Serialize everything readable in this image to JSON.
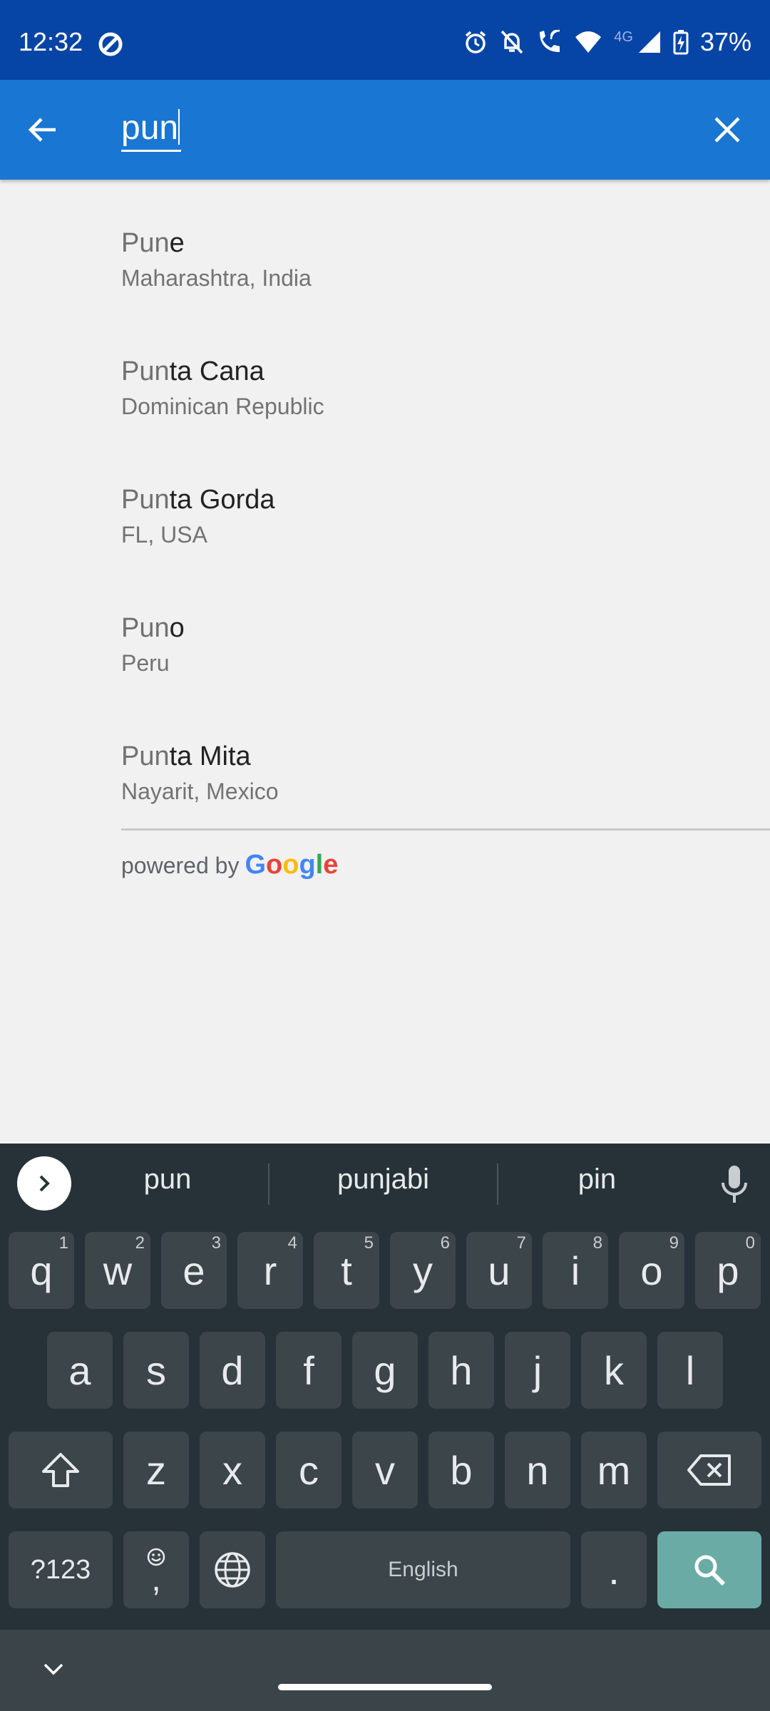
{
  "status": {
    "time": "12:32",
    "network": "4G",
    "battery": "37%"
  },
  "search": {
    "query": "pun"
  },
  "results": [
    {
      "match": "Pun",
      "rest": "e",
      "subtitle": "Maharashtra, India"
    },
    {
      "match": "Pun",
      "rest": "ta Cana",
      "subtitle": "Dominican Republic"
    },
    {
      "match": "Pun",
      "rest": "ta Gorda",
      "subtitle": "FL, USA"
    },
    {
      "match": "Pun",
      "rest": "o",
      "subtitle": "Peru"
    },
    {
      "match": "Pun",
      "rest": "ta Mita",
      "subtitle": "Nayarit, Mexico"
    }
  ],
  "attribution": {
    "powered_by": "powered by",
    "brand": "Google"
  },
  "keyboard": {
    "suggestions": [
      "pun",
      "punjabi",
      "pin"
    ],
    "row1": [
      [
        "q",
        "1"
      ],
      [
        "w",
        "2"
      ],
      [
        "e",
        "3"
      ],
      [
        "r",
        "4"
      ],
      [
        "t",
        "5"
      ],
      [
        "y",
        "6"
      ],
      [
        "u",
        "7"
      ],
      [
        "i",
        "8"
      ],
      [
        "o",
        "9"
      ],
      [
        "p",
        "0"
      ]
    ],
    "row2": [
      "a",
      "s",
      "d",
      "f",
      "g",
      "h",
      "j",
      "k",
      "l"
    ],
    "row3": [
      "z",
      "x",
      "c",
      "v",
      "b",
      "n",
      "m"
    ],
    "symbols_key": "?123",
    "emoji_comma": ",",
    "space_label": "English",
    "period": "."
  },
  "colors": {
    "status_bar": "#0645a6",
    "app_bar": "#1976d2",
    "keyboard_bg": "#263238",
    "key_bg": "#3c4549",
    "search_key": "#6aaba6"
  }
}
